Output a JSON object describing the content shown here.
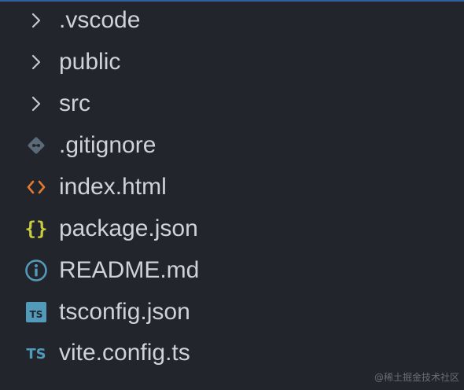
{
  "explorer": {
    "items": [
      {
        "type": "folder",
        "label": ".vscode",
        "icon": "chevron-right-icon"
      },
      {
        "type": "folder",
        "label": "public",
        "icon": "chevron-right-icon"
      },
      {
        "type": "folder",
        "label": "src",
        "icon": "chevron-right-icon"
      },
      {
        "type": "file",
        "label": ".gitignore",
        "icon": "git-icon"
      },
      {
        "type": "file",
        "label": "index.html",
        "icon": "html-icon"
      },
      {
        "type": "file",
        "label": "package.json",
        "icon": "json-icon"
      },
      {
        "type": "file",
        "label": "README.md",
        "icon": "info-icon"
      },
      {
        "type": "file",
        "label": "tsconfig.json",
        "icon": "tsconfig-icon"
      },
      {
        "type": "file",
        "label": "vite.config.ts",
        "icon": "typescript-icon"
      }
    ]
  },
  "watermark": "@稀土掘金技术社区",
  "colors": {
    "background": "#22252b",
    "text": "#cfd2d8",
    "chevron": "#c5c8ce",
    "git": "#5a6a78",
    "html": "#e37933",
    "json": "#cbcb41",
    "info": "#519aba",
    "typescript": "#519aba"
  }
}
